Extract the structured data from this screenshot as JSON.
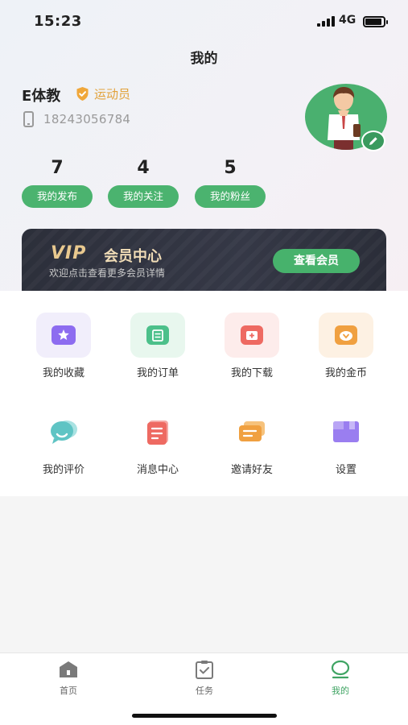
{
  "status_bar": {
    "time": "15:23",
    "network": "4G"
  },
  "page_title": "我的",
  "profile": {
    "name": "E体教",
    "role": "运动员",
    "phone": "18243056784"
  },
  "stats": [
    {
      "value": "7",
      "label": "我的发布"
    },
    {
      "value": "4",
      "label": "我的关注"
    },
    {
      "value": "5",
      "label": "我的粉丝"
    }
  ],
  "vip": {
    "logo": "VIP",
    "title": "会员中心",
    "subtitle": "欢迎点击查看更多会员详情",
    "button": "查看会员"
  },
  "menu": [
    {
      "label": "我的收藏",
      "icon": "star-icon",
      "color": "#8d6cf0",
      "bg": "#f1eefb"
    },
    {
      "label": "我的订单",
      "icon": "order-icon",
      "color": "#4cc08a",
      "bg": "#e8f7ee"
    },
    {
      "label": "我的下载",
      "icon": "download-icon",
      "color": "#ee6a62",
      "bg": "#fdeceb"
    },
    {
      "label": "我的金币",
      "icon": "coin-icon",
      "color": "#f0a040",
      "bg": "#fdf1e3"
    },
    {
      "label": "我的评价",
      "icon": "comment-icon",
      "color": "#5fc4c4",
      "bg": ""
    },
    {
      "label": "消息中心",
      "icon": "message-icon",
      "color": "#ee6a62",
      "bg": ""
    },
    {
      "label": "邀请好友",
      "icon": "invite-icon",
      "color": "#f0a040",
      "bg": ""
    },
    {
      "label": "设置",
      "icon": "settings-icon",
      "color": "#9a7ef0",
      "bg": ""
    }
  ],
  "tabbar": [
    {
      "label": "首页",
      "icon": "home-icon",
      "active": false
    },
    {
      "label": "任务",
      "icon": "task-icon",
      "active": false
    },
    {
      "label": "我的",
      "icon": "profile-icon",
      "active": true
    }
  ],
  "colors": {
    "accent": "#4bb36f",
    "gold": "#e2a23a"
  }
}
